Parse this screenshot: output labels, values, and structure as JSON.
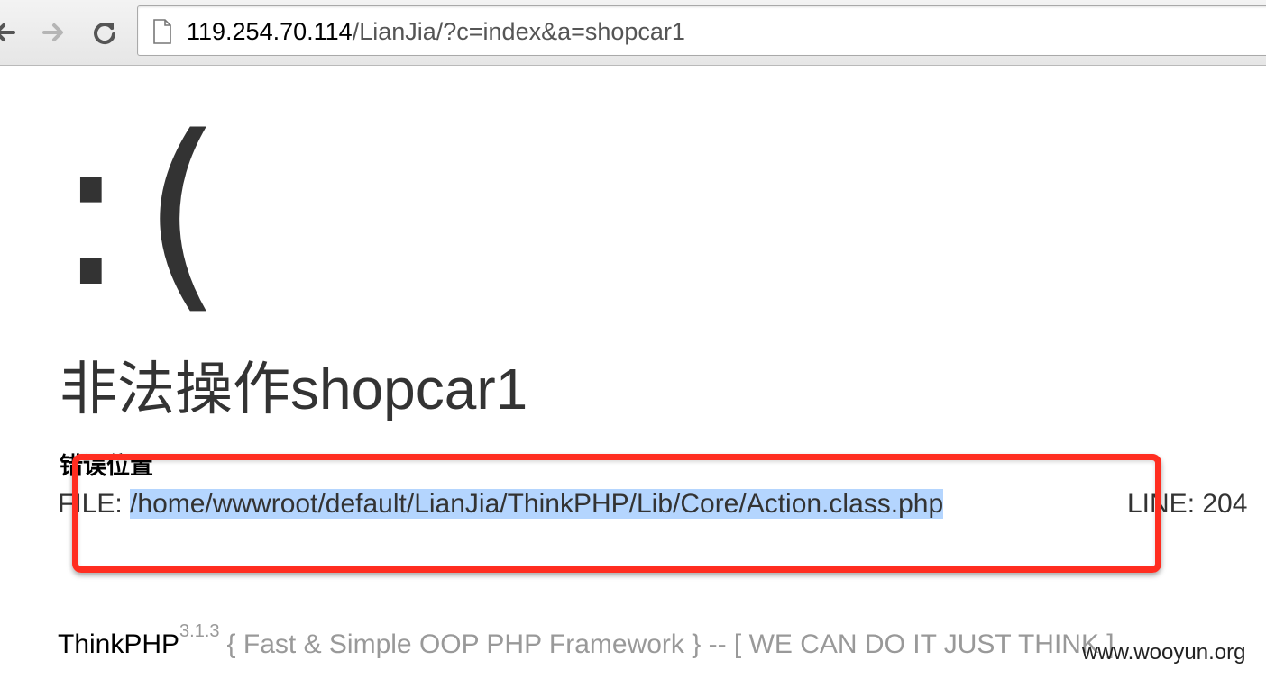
{
  "browser": {
    "url_host": "119.254.70.114",
    "url_path": "/LianJia/?c=index&a=shopcar1",
    "back_icon": "arrow-left-icon",
    "forward_icon": "arrow-right-icon",
    "reload_icon": "reload-icon",
    "page_icon": "document-icon"
  },
  "error": {
    "face": ":(",
    "title": "非法操作shopcar1",
    "location_label": "错误位置",
    "file_label": "FILE:",
    "file_path": "/home/wwwroot/default/LianJia/ThinkPHP/Lib/Core/Action.class.php",
    "line_label": "LINE: 204"
  },
  "annotation": {
    "color": "#ff2d20"
  },
  "footer": {
    "framework": "ThinkPHP",
    "version": "3.1.3",
    "tagline": "{ Fast & Simple OOP PHP Framework } -- [ WE CAN DO IT JUST THINK ]"
  },
  "watermark": {
    "text": "www.wooyun.org"
  }
}
